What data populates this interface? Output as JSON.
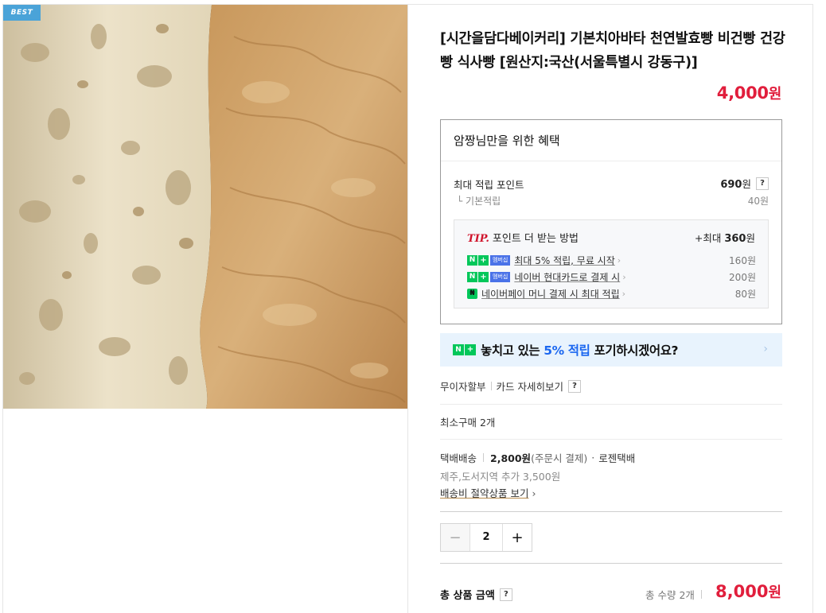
{
  "product": {
    "badge": "BEST",
    "title": "[시간을담다베이커리] 기본치아바타 천연발효빵 비건빵 건강빵 식사빵 [원산지:국산(서울특별시 강동구)]",
    "price_value": "4,000",
    "price_unit": "원"
  },
  "benefit": {
    "heading": "암짱님만을 위한 혜택",
    "max_points_label": "최대 적립 포인트",
    "max_points_value": "690",
    "max_points_unit": "원",
    "help_icon": "?",
    "base_label": "└ 기본적립",
    "base_value": "40원",
    "tip": {
      "tip_word": "TIP.",
      "title": "포인트 더 받는 방법",
      "max_prefix": "+최대",
      "max_value": "360",
      "max_unit": "원",
      "items": [
        {
          "label": "최대 5% 적립, 무료 시작",
          "amount": "160원",
          "badge": "멤버십"
        },
        {
          "label": "네이버 현대카드로 결제 시",
          "amount": "200원",
          "badge": "멤버십"
        },
        {
          "label": "네이버페이 머니 결제 시 최대 적립",
          "amount": "80원",
          "badge": ""
        }
      ]
    }
  },
  "banner": {
    "text_before": "놓치고 있는 ",
    "highlight": "5% 적립",
    "text_after": " 포기하시겠어요?",
    "chevron": "›"
  },
  "payment": {
    "installment": "무이자할부",
    "card_detail": "카드 자세히보기",
    "help_icon": "?"
  },
  "min_purchase": "최소구매 2개",
  "shipping": {
    "method": "택배배송",
    "fee": "2,800원",
    "fee_note": "(주문시 결제)",
    "courier": "로젠택배",
    "extra": "제주,도서지역 추가 3,500원",
    "saving_link": "배송비 절약상품 보기",
    "chevron": "›"
  },
  "quantity": {
    "minus": "−",
    "value": "2",
    "plus": "+"
  },
  "total": {
    "label": "총 상품 금액",
    "help_icon": "?",
    "qty_text": "총 수량 2개",
    "price_value": "8,000",
    "price_unit": "원"
  }
}
